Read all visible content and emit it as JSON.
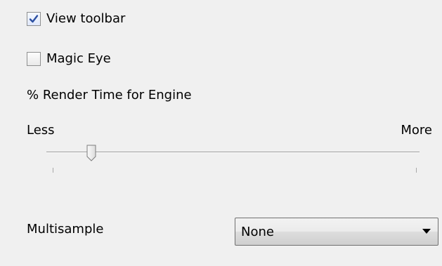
{
  "options": {
    "view_toolbar": {
      "label": "View toolbar",
      "checked": true
    },
    "magic_eye": {
      "label": "Magic Eye",
      "checked": false
    }
  },
  "render_time": {
    "title": "% Render Time for Engine",
    "min_label": "Less",
    "max_label": "More",
    "value_fraction": 0.11
  },
  "multisample": {
    "label": "Multisample",
    "selected": "None"
  },
  "icons": {
    "checkmark": "check-icon",
    "dropdown_arrow": "chevron-down-icon"
  },
  "colors": {
    "background": "#f0f0f0",
    "check_mark": "#2b4fa1",
    "border": "#8e8f8f"
  }
}
